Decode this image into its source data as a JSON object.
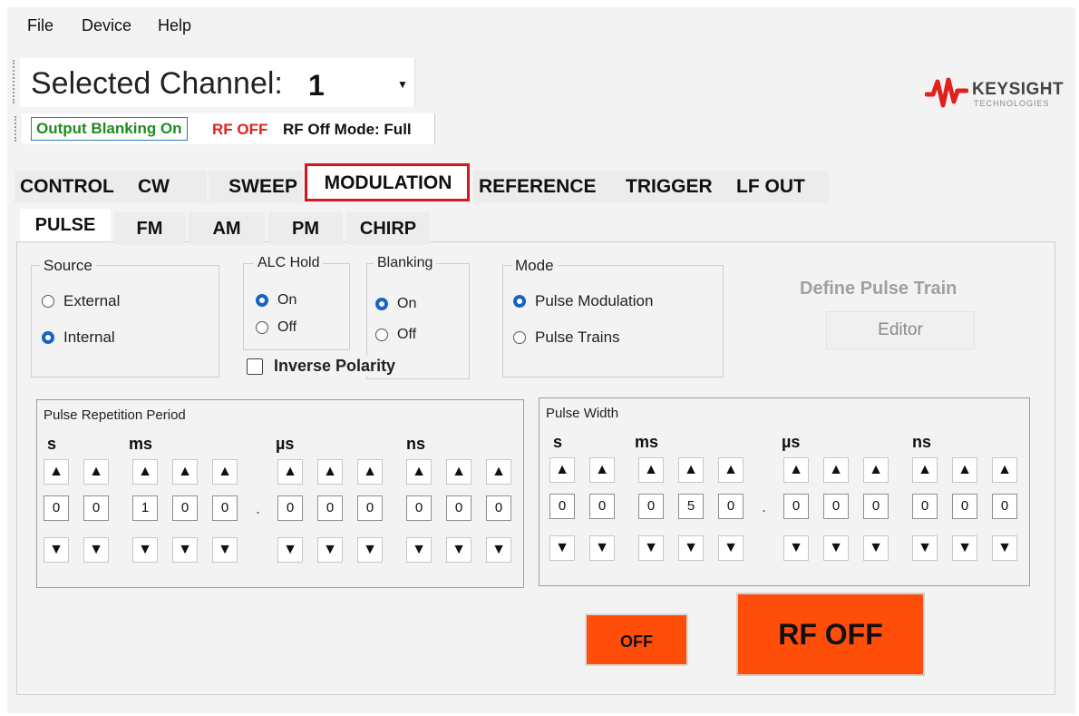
{
  "menu": {
    "file": "File",
    "device": "Device",
    "help": "Help"
  },
  "channel": {
    "label": "Selected Channel:",
    "value": "1"
  },
  "status": {
    "blanking": "Output Blanking On",
    "rf": "RF OFF",
    "off_mode": "RF Off Mode: Full"
  },
  "logo": {
    "name": "KEYSIGHT",
    "sub": "TECHNOLOGIES",
    "color": "#e0211d"
  },
  "tabs": [
    "CONTROL",
    "CW",
    "SWEEP",
    "MODULATION",
    "REFERENCE",
    "TRIGGER",
    "LF OUT"
  ],
  "active_tab": "MODULATION",
  "subtabs": [
    "PULSE",
    "FM",
    "AM",
    "PM",
    "CHIRP"
  ],
  "active_subtab": "PULSE",
  "source": {
    "title": "Source",
    "options": [
      "External",
      "Internal"
    ],
    "selected": "Internal"
  },
  "alc_hold": {
    "title": "ALC Hold",
    "options": [
      "On",
      "Off"
    ],
    "selected": "On"
  },
  "blanking": {
    "title": "Blanking",
    "options": [
      "On",
      "Off"
    ],
    "selected": "On"
  },
  "inverse_polarity": {
    "label": "Inverse Polarity",
    "checked": false
  },
  "mode": {
    "title": "Mode",
    "options": [
      "Pulse Modulation",
      "Pulse Trains"
    ],
    "selected": "Pulse Modulation"
  },
  "pulse_train": {
    "title": "Define Pulse Train",
    "button": "Editor"
  },
  "prp": {
    "title": "Pulse Repetition Period",
    "units": [
      "s",
      "ms",
      "µs",
      "ns"
    ],
    "digits": [
      "0",
      "0",
      "1",
      "0",
      "0",
      "0",
      "0",
      "0",
      "0",
      "0",
      "0"
    ]
  },
  "pw": {
    "title": "Pulse Width",
    "units": [
      "s",
      "ms",
      "µs",
      "ns"
    ],
    "digits": [
      "0",
      "0",
      "0",
      "5",
      "0",
      "0",
      "0",
      "0",
      "0",
      "0",
      "0"
    ]
  },
  "buttons": {
    "off": "OFF",
    "rf_off": "RF OFF"
  },
  "colors": {
    "accent": "#1565c0",
    "rf_button": "#ff4d0a",
    "highlight": "#d7171f",
    "blanking_text": "#1e8c1e"
  }
}
